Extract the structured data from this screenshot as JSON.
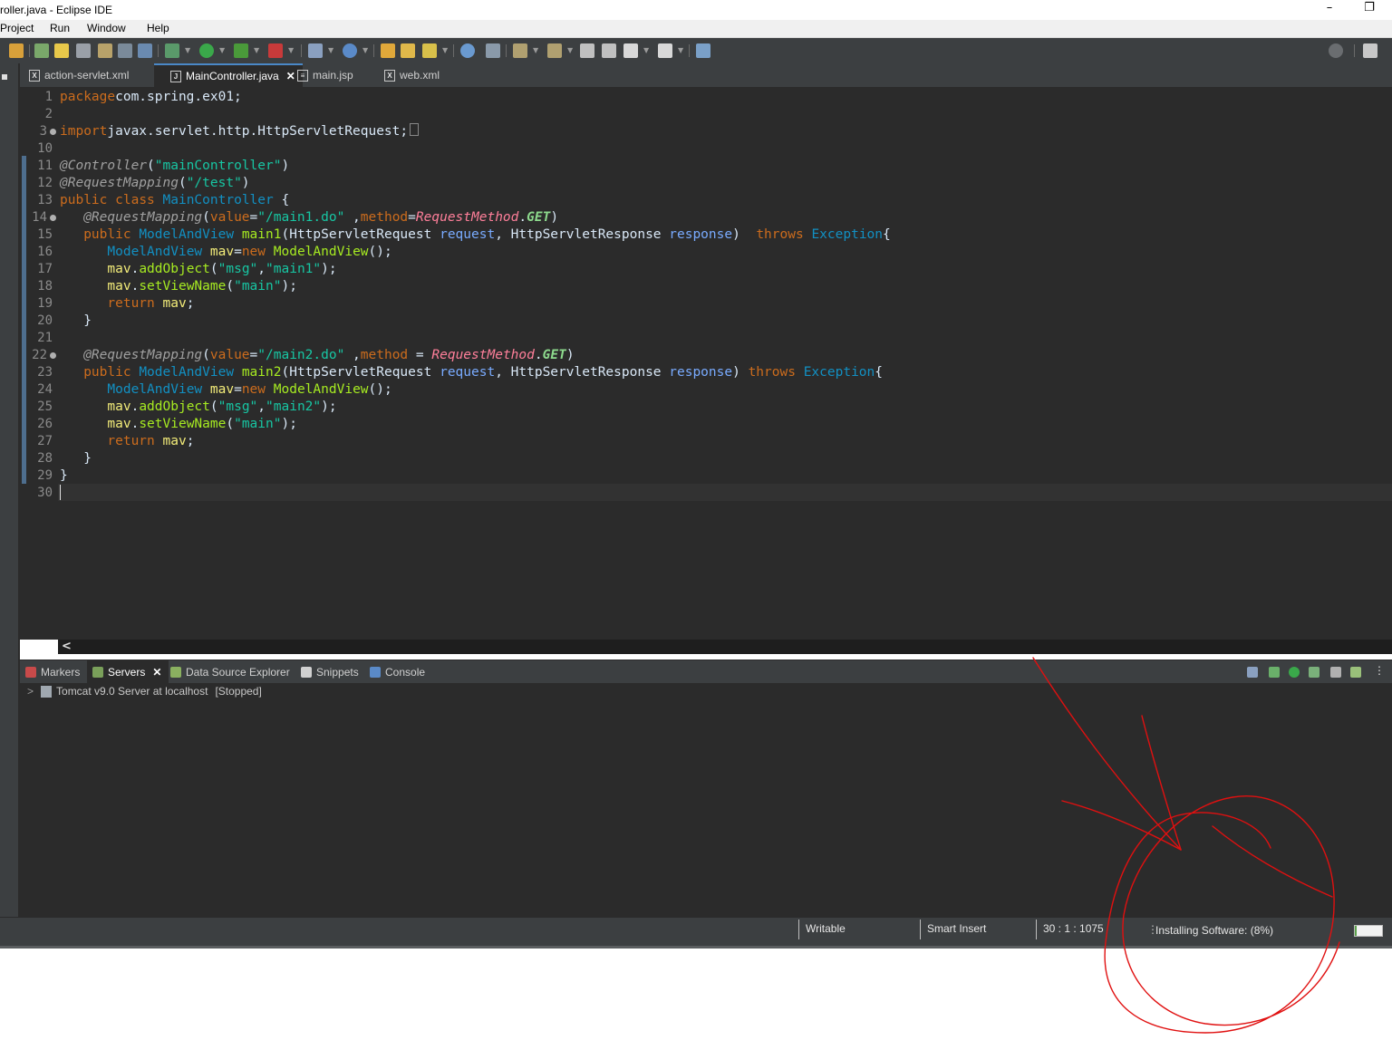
{
  "window": {
    "title": "roller.java - Eclipse IDE",
    "minimize": "–",
    "restore": "❐"
  },
  "menu": [
    "Project",
    "Run",
    "Window",
    "Help"
  ],
  "tabs": [
    {
      "label": "action-servlet.xml",
      "icon": "X"
    },
    {
      "label": "MainController.java",
      "icon": "J",
      "close": "✕"
    },
    {
      "label": "main.jsp",
      "icon": "≡"
    },
    {
      "label": "web.xml",
      "icon": "X"
    }
  ],
  "editor": {
    "line_numbers": [
      "1",
      "2",
      "3",
      "10",
      "11",
      "12",
      "13",
      "14",
      "15",
      "16",
      "17",
      "18",
      "19",
      "20",
      "21",
      "22",
      "23",
      "24",
      "25",
      "26",
      "27",
      "28",
      "29",
      "30"
    ],
    "scroll_arrow": "<"
  },
  "panel": {
    "tabs": [
      "Markers",
      "Servers",
      "Data Source Explorer",
      "Snippets",
      "Console"
    ],
    "servers_close": "✕",
    "server_row": {
      "expander": ">",
      "name": "Tomcat v9.0 Server at localhost",
      "state": "[Stopped]"
    }
  },
  "status": {
    "writable": "Writable",
    "insert_mode": "Smart Insert",
    "position": "30 : 1 : 1075",
    "progress_text": "Installing Software: (8%)",
    "progress_fraction": 0.08
  },
  "colors": {
    "annotation": "#e01010",
    "accent": "#4a88c7"
  }
}
